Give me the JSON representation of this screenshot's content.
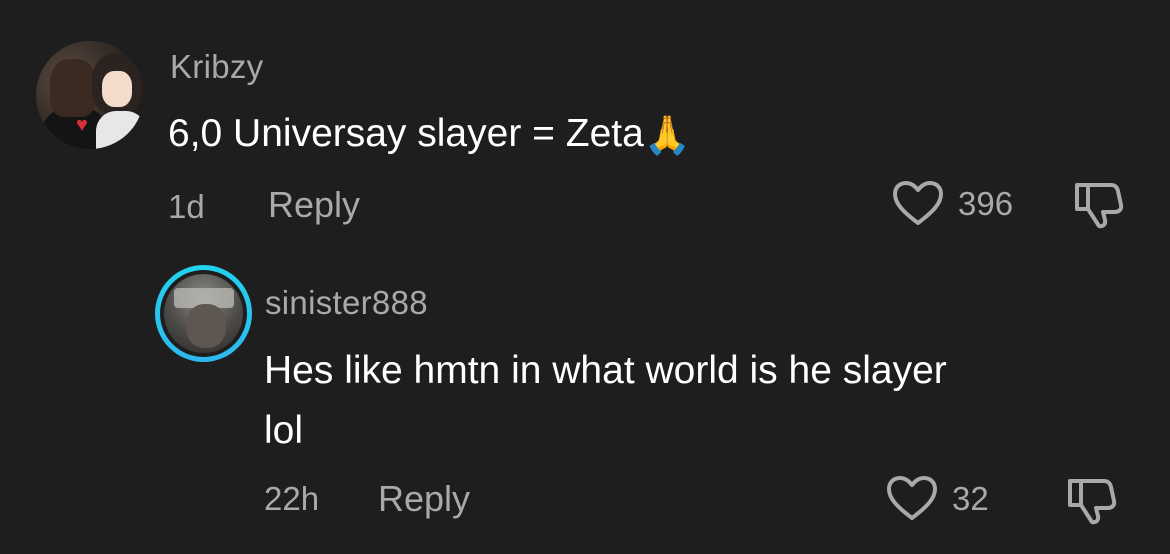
{
  "comments": [
    {
      "username": "Kribzy",
      "text": "6,0 Universay slayer = Zeta",
      "emoji": "🙏",
      "time": "1d",
      "reply_label": "Reply",
      "likes": "396",
      "icons": {
        "like": "heart-outline-icon",
        "dislike": "thumbs-down-icon"
      }
    },
    {
      "username": "sinister888",
      "text_line1": "Hes like hmtn in what world is he slayer",
      "text_line2": "lol",
      "time": "22h",
      "reply_label": "Reply",
      "likes": "32",
      "icons": {
        "like": "heart-outline-icon",
        "dislike": "thumbs-down-icon"
      }
    }
  ],
  "colors": {
    "background": "#1e1e1e",
    "secondary_text": "#a9a9a9",
    "primary_text": "#ffffff",
    "story_ring": "#20d5ec"
  }
}
